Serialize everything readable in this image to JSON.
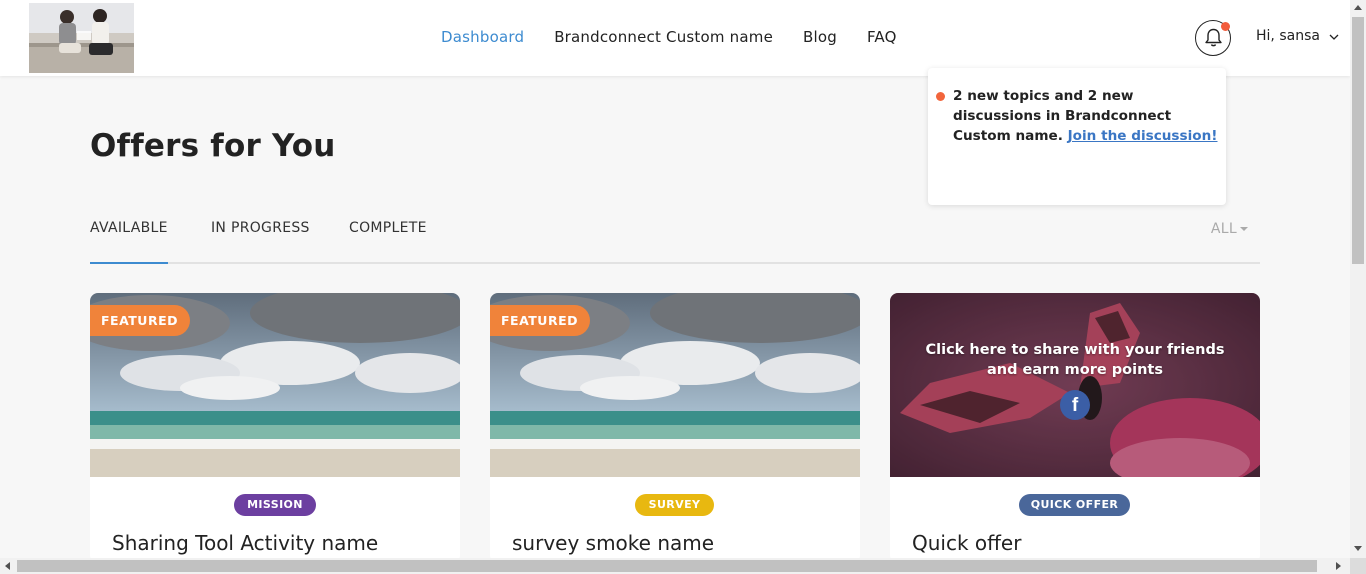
{
  "header": {
    "nav": [
      {
        "label": "Dashboard",
        "active": true
      },
      {
        "label": "Brandconnect Custom name",
        "active": false
      },
      {
        "label": "Blog",
        "active": false
      },
      {
        "label": "FAQ",
        "active": false
      }
    ],
    "user_greeting": "Hi, sansa",
    "icons": {
      "notifications": "bell-icon",
      "user_menu": "chevron-down-icon"
    }
  },
  "notification": {
    "text": "2 new topics and 2 new discussions in Brandconnect Custom name.",
    "link": "Join the discussion!"
  },
  "page": {
    "title": "Offers for You"
  },
  "tabs": {
    "items": [
      "AVAILABLE",
      "IN PROGRESS",
      "COMPLETE"
    ],
    "active": "AVAILABLE",
    "filter": "ALL"
  },
  "cards": [
    {
      "featured": "FEATURED",
      "type": "MISSION",
      "type_color": "#6c3fa0",
      "title": "Sharing Tool Activity name"
    },
    {
      "featured": "FEATURED",
      "type": "SURVEY",
      "type_color": "#e8b810",
      "title": "survey smoke name"
    },
    {
      "share_text": "Click here to share with your friends and earn more points",
      "share_icon": "facebook-icon",
      "type": "QUICK OFFER",
      "type_color": "#4a679a",
      "title": "Quick offer"
    }
  ],
  "colors": {
    "accent": "#3d8bd0",
    "featured": "#f0833a",
    "notification_dot": "#f25c3c"
  }
}
